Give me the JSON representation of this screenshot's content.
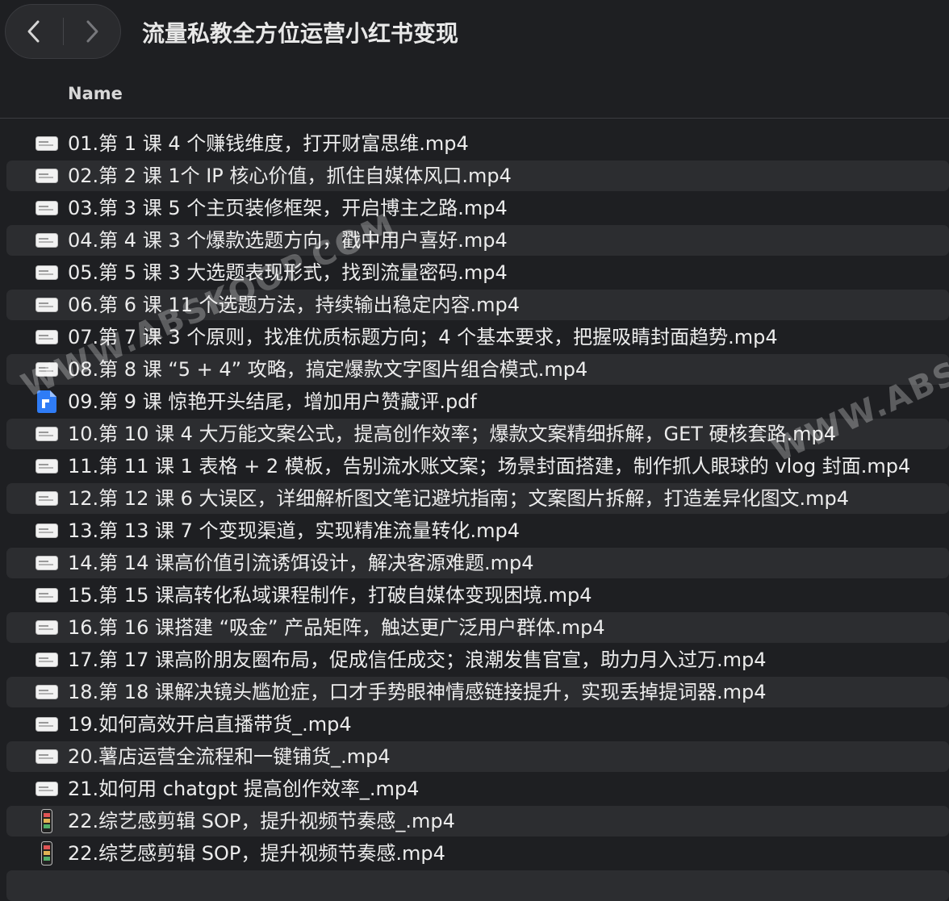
{
  "window": {
    "title": "流量私教全方位运营小红书变现"
  },
  "columns": {
    "name": "Name"
  },
  "files": [
    {
      "name": "01.第 1 课 4 个赚钱维度，打开财富思维.mp4",
      "icon": "video-thumbnail-icon"
    },
    {
      "name": "02.第 2 课 1个 IP 核心价值，抓住自媒体风口.mp4",
      "icon": "video-thumbnail-icon"
    },
    {
      "name": "03.第 3 课 5 个主页装修框架，开启博主之路.mp4",
      "icon": "video-thumbnail-icon"
    },
    {
      "name": "04.第 4 课 3 个爆款选题方向，戳中用户喜好.mp4",
      "icon": "video-thumbnail-icon"
    },
    {
      "name": "05.第 5 课 3 大选题表现形式，找到流量密码.mp4",
      "icon": "video-thumbnail-icon"
    },
    {
      "name": "06.第 6 课 11 个选题方法，持续输出稳定内容.mp4",
      "icon": "video-thumbnail-icon"
    },
    {
      "name": "07.第 7 课 3 个原则，找准优质标题方向；4 个基本要求，把握吸睛封面趋势.mp4",
      "icon": "video-thumbnail-icon"
    },
    {
      "name": "08.第 8 课 “5 + 4” 攻略，搞定爆款文字图片组合模式.mp4",
      "icon": "video-thumbnail-icon"
    },
    {
      "name": "09.第 9 课 惊艳开头结尾，增加用户赞藏评.pdf",
      "icon": "pdf-icon"
    },
    {
      "name": "10.第 10 课 4 大万能文案公式，提高创作效率；爆款文案精细拆解，GET 硬核套路.mp4",
      "icon": "video-thumbnail-icon"
    },
    {
      "name": "11.第 11 课 1 表格 + 2 模板，告别流水账文案；场景封面搭建，制作抓人眼球的 vlog 封面.mp4",
      "icon": "video-thumbnail-icon"
    },
    {
      "name": "12.第 12 课 6 大误区，详细解析图文笔记避坑指南；文案图片拆解，打造差异化图文.mp4",
      "icon": "video-thumbnail-icon"
    },
    {
      "name": "13.第 13 课 7 个变现渠道，实现精准流量转化.mp4",
      "icon": "video-thumbnail-icon"
    },
    {
      "name": "14.第 14 课高价值引流诱饵设计，解决客源难题.mp4",
      "icon": "video-thumbnail-icon"
    },
    {
      "name": "15.第 15 课高转化私域课程制作，打破自媒体变现困境.mp4",
      "icon": "video-thumbnail-icon"
    },
    {
      "name": "16.第 16 课搭建 “吸金” 产品矩阵，触达更广泛用户群体.mp4",
      "icon": "video-thumbnail-icon"
    },
    {
      "name": "17.第 17 课高阶朋友圈布局，促成信任成交；浪潮发售官宣，助力月入过万.mp4",
      "icon": "video-thumbnail-icon"
    },
    {
      "name": "18.第 18 课解决镜头尴尬症，口才手势眼神情感链接提升，实现丢掉提词器.mp4",
      "icon": "video-thumbnail-icon"
    },
    {
      "name": "19.如何高效开启直播带货_.mp4",
      "icon": "video-thumbnail-icon"
    },
    {
      "name": "20.薯店运营全流程和一键铺货_.mp4",
      "icon": "video-thumbnail-icon"
    },
    {
      "name": "21.如何用 chatgpt 提高创作效率_.mp4",
      "icon": "video-thumbnail-icon"
    },
    {
      "name": "22.综艺感剪辑 SOP，提升视频节奏感_.mp4",
      "icon": "phone-video-icon"
    },
    {
      "name": "22.综艺感剪辑 SOP，提升视频节奏感.mp4",
      "icon": "phone-video-icon"
    }
  ],
  "watermarks": [
    "WWW.ABSKOOP.COM",
    "WWW.ABSK"
  ]
}
